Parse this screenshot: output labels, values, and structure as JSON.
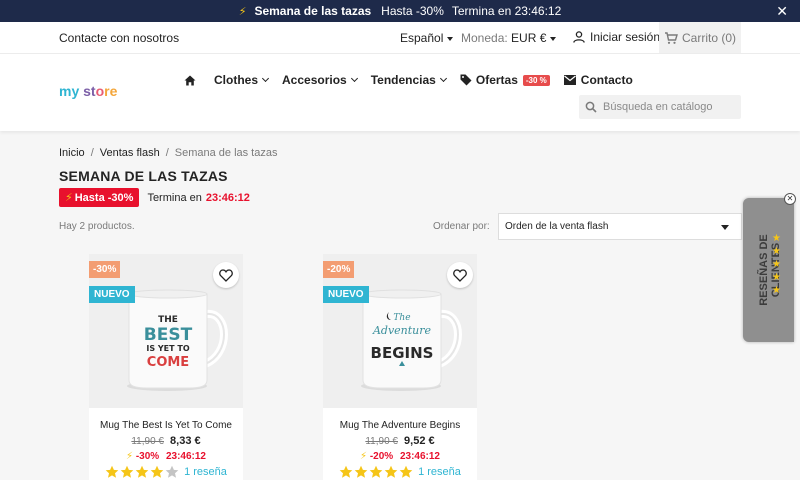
{
  "banner": {
    "title": "Semana de las tazas",
    "discount": "Hasta -30%",
    "ends_label": "Termina en 23:46:12",
    "close": "✕"
  },
  "userbar": {
    "contact": "Contacte con nosotros",
    "language": "Español",
    "currency_label": "Moneda:",
    "currency_value": "EUR €",
    "login": "Iniciar sesión",
    "cart": "Carrito (0)"
  },
  "header": {
    "logo": {
      "p1": "my ",
      "p2": "st",
      "p3": "o",
      "p4": "re"
    },
    "nav": {
      "clothes": "Clothes",
      "accesorios": "Accesorios",
      "tendencias": "Tendencias",
      "ofertas": "Ofertas",
      "ofertas_badge": "-30 %",
      "contacto": "Contacto"
    },
    "search_placeholder": "Búsqueda en catálogo"
  },
  "breadcrumb": {
    "home": "Inicio",
    "ventas": "Ventas flash",
    "current": "Semana de las tazas",
    "sep": "/"
  },
  "page": {
    "title": "SEMANA DE LAS TAZAS",
    "promo_pill": "Hasta -30%",
    "ends_prefix": "Termina en",
    "ends_time": "23:46:12",
    "count": "Hay 2 productos.",
    "sort_label": "Ordenar por:",
    "sort_value": "Orden de la venta flash"
  },
  "products": [
    {
      "discount": "-30%",
      "new_label": "NUEVO",
      "name": "Mug The Best Is Yet To Come",
      "old_price": "11,90 €",
      "price": "8,33 €",
      "flash_discount": "-30%",
      "flash_time": "23:46:12",
      "rating": 4,
      "reviews": "1 reseña"
    },
    {
      "discount": "-20%",
      "new_label": "NUEVO",
      "name": "Mug The Adventure Begins",
      "old_price": "11,90 €",
      "price": "9,52 €",
      "flash_discount": "-20%",
      "flash_time": "23:46:12",
      "rating": 5,
      "reviews": "1 reseña"
    }
  ],
  "mug_art": {
    "best": {
      "l1": "THE",
      "l2": "BEST",
      "l3": "IS YET TO",
      "l4": "COME"
    },
    "adventure": {
      "l1": "The",
      "l2": "Adventure",
      "l3": "BEGINS"
    }
  },
  "reviews_tab": {
    "label": "RESEÑAS DE CLIENTES",
    "close": "✕"
  },
  "colors": {
    "banner_bg": "#1e2a4a",
    "accent": "#2fb5d2",
    "discount_badge": "#f39d72",
    "flash_red": "#e8112d",
    "star": "#f5c518"
  }
}
